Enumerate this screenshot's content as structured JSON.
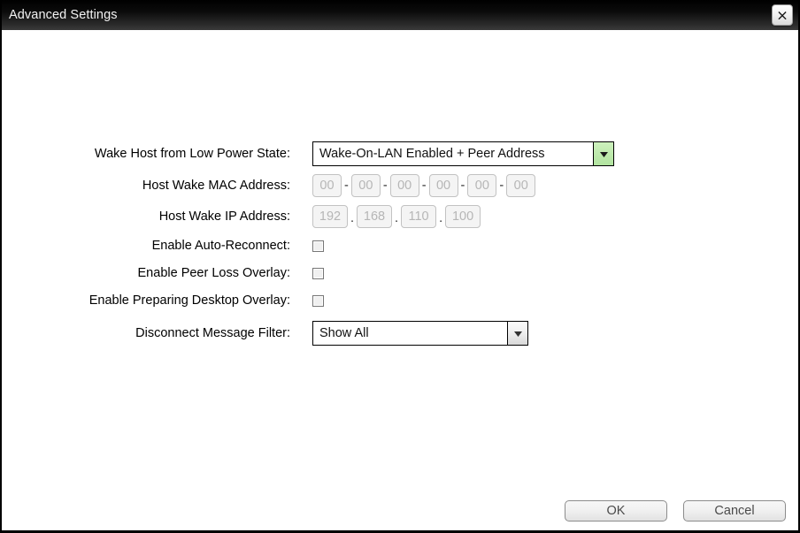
{
  "window": {
    "title": "Advanced Settings",
    "close_icon": "close-icon",
    "close_glyph": "✕"
  },
  "form": {
    "rows": [
      {
        "label": "Wake Host from Low Power State:",
        "type": "combo",
        "value": "Wake-On-LAN Enabled + Peer Address",
        "arrow_style": "green",
        "arrow_icon": "chevron-down-icon"
      },
      {
        "label": "Host Wake MAC Address:",
        "type": "mac",
        "segments": [
          "00",
          "00",
          "00",
          "00",
          "00",
          "00"
        ],
        "separator": "-"
      },
      {
        "label": "Host Wake IP Address:",
        "type": "ip",
        "segments": [
          "192",
          "168",
          "110",
          "100"
        ],
        "separator": "."
      },
      {
        "label": "Enable Auto-Reconnect:",
        "type": "checkbox",
        "checked": false
      },
      {
        "label": "Enable Peer Loss Overlay:",
        "type": "checkbox",
        "checked": false
      },
      {
        "label": "Enable Preparing Desktop Overlay:",
        "type": "checkbox",
        "checked": false
      },
      {
        "label": "Disconnect Message Filter:",
        "type": "combo",
        "value": "Show All",
        "arrow_style": "grey",
        "arrow_icon": "chevron-down-icon"
      }
    ]
  },
  "footer": {
    "ok_label": "OK",
    "cancel_label": "Cancel"
  },
  "colors": {
    "titlebar_top": "#000000",
    "titlebar_bottom": "#3a3a3a",
    "accent_green": "#bfeaae",
    "placeholder_grey": "#b6b6b6",
    "button_face": "#f0f0f0"
  }
}
